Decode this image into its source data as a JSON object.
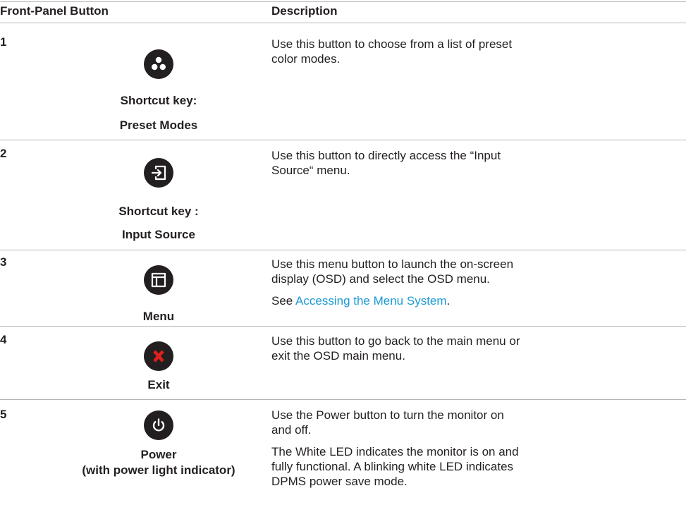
{
  "header": {
    "col1": "Front-Panel Button",
    "col2": "Description"
  },
  "rows": [
    {
      "number": "1",
      "icon": "preset-modes-icon",
      "caption1": "Shortcut key:",
      "caption2": "Preset Modes",
      "desc1": "Use this button to choose from a list of preset color modes."
    },
    {
      "number": "2",
      "icon": "input-source-icon",
      "caption1": "Shortcut key :",
      "caption2": "Input Source",
      "desc1": "Use this button to directly access the “Input Source“ menu."
    },
    {
      "number": "3",
      "icon": "menu-icon",
      "caption1": "Menu",
      "desc1": "Use this menu button to launch the on-screen display (OSD) and select the OSD menu.",
      "desc2_prefix": "See ",
      "desc2_link": "Accessing the Menu System",
      "desc2_suffix": "."
    },
    {
      "number": "4",
      "icon": "exit-icon",
      "caption1": "Exit",
      "desc1": "Use this button to go back to the main menu or exit the OSD main menu."
    },
    {
      "number": "5",
      "icon": "power-icon",
      "caption1": "Power",
      "caption2": "(with power light indicator)",
      "desc1": "Use the Power button to turn the monitor on and off.",
      "desc2": "The White LED indicates the monitor is on and fully functional. A blinking white LED indicates DPMS power save mode."
    }
  ],
  "colors": {
    "text": "#231f20",
    "rule": "#b5b5b5",
    "link": "#1a9ad6",
    "exit_x": "#e0201b"
  }
}
